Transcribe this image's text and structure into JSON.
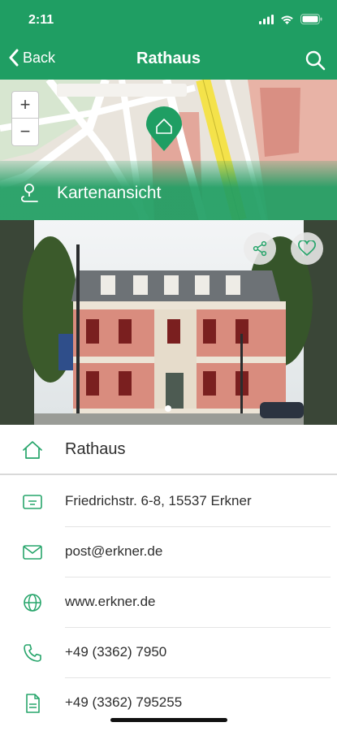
{
  "status_bar": {
    "time": "2:11"
  },
  "nav": {
    "back_label": "Back",
    "title": "Rathaus"
  },
  "map": {
    "zoom_in": "+",
    "zoom_out": "−",
    "link_label": "Kartenansicht"
  },
  "photo": {
    "alt": "Rathaus Erkner"
  },
  "details": {
    "name": "Rathaus",
    "address": "Friedrichstr. 6-8, 15537 Erkner",
    "email": "post@erkner.de",
    "website": "www.erkner.de",
    "phone": "+49 (3362) 7950",
    "fax": "+49 (3362) 795255"
  },
  "colors": {
    "accent": "#1f9e63",
    "icon": "#27a56b"
  }
}
